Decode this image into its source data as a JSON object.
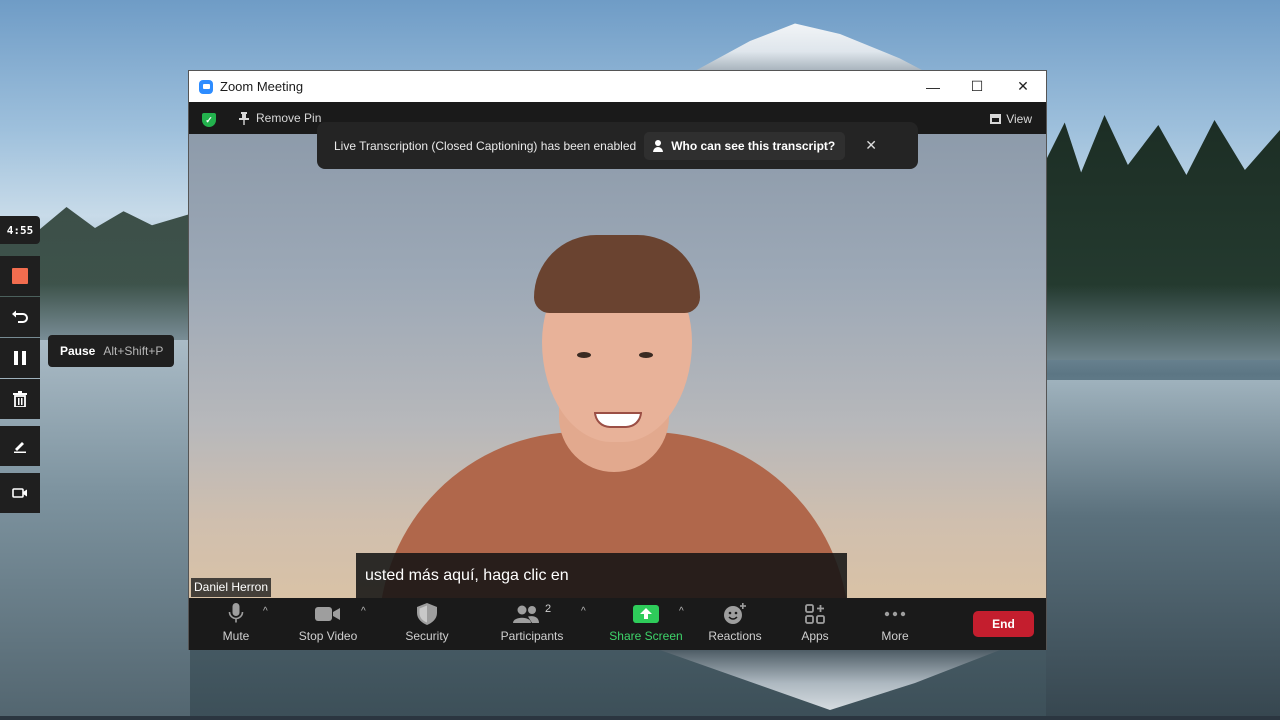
{
  "recorder": {
    "timer": "4:55",
    "pause_tooltip": {
      "label": "Pause",
      "shortcut": "Alt+Shift+P"
    },
    "buttons": [
      "stop-icon",
      "undo-icon",
      "pause-icon",
      "trash-icon",
      "pen-icon",
      "camera-icon"
    ]
  },
  "window": {
    "title": "Zoom Meeting",
    "controls": {
      "minimize": "—",
      "maximize": "☐",
      "close": "✕"
    }
  },
  "meeting": {
    "remove_pin": "Remove Pin",
    "view": "View",
    "banner": {
      "text": "Live Transcription (Closed Captioning) has been enabled",
      "who_label": "Who can see this transcript?",
      "close": "✕"
    },
    "caption": "usted más aquí, haga clic en",
    "participant_name": "Daniel Herron",
    "colors": {
      "accent_green": "#3ed46a",
      "end_red": "#c41e2e",
      "zoom_blue": "#2d8cff"
    }
  },
  "toolbar": {
    "mute": "Mute",
    "stop_video": "Stop Video",
    "security": "Security",
    "participants": "Participants",
    "participants_count": "2",
    "share_screen": "Share Screen",
    "reactions": "Reactions",
    "apps": "Apps",
    "more": "More",
    "end": "End",
    "caret": "^"
  }
}
